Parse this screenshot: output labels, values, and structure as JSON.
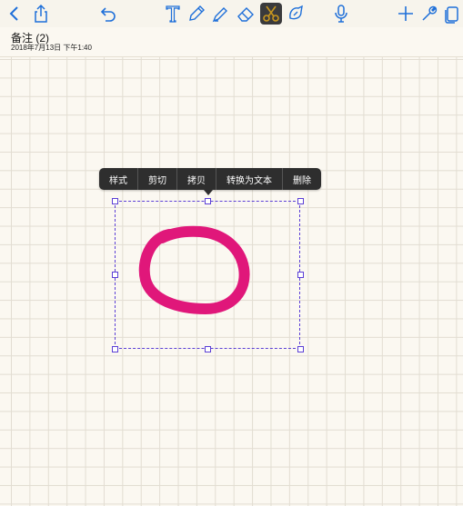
{
  "toolbar": {
    "icons": {
      "back": "chevron-left-icon",
      "share": "share-icon",
      "undo": "undo-icon",
      "text": "text-tool-icon",
      "pen": "pen-icon",
      "highlighter": "highlighter-icon",
      "eraser": "eraser-icon",
      "lasso": "lasso-scissors-icon",
      "shape": "shape-tool-icon",
      "mic": "microphone-icon",
      "add": "plus-icon",
      "settings": "wrench-icon",
      "pages": "pages-icon"
    },
    "accent": "#1e6fd9",
    "lasso_color": "#c8961e"
  },
  "note": {
    "title": "备注 (2)",
    "timestamp": "2018年7月13日 下午1:40"
  },
  "context_menu": {
    "items": [
      "样式",
      "剪切",
      "拷贝",
      "转换为文本",
      "删除"
    ]
  },
  "ink": {
    "color": "#e0177a",
    "shape": "circle"
  },
  "selection": {
    "border_color": "#5b3fd6"
  }
}
